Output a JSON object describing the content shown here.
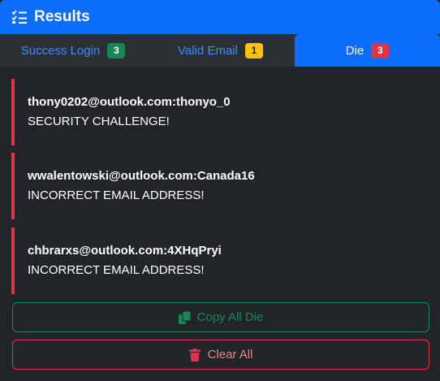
{
  "header": {
    "title": "Results",
    "icon": "list-check-icon"
  },
  "tabs": [
    {
      "label": "Success Login",
      "count": "3",
      "badge_color": "#198754"
    },
    {
      "label": "Valid Email",
      "count": "1",
      "badge_color": "#ffc107"
    },
    {
      "label": "Die",
      "count": "3",
      "badge_color": "#dc3545",
      "active": true
    }
  ],
  "results": [
    {
      "account": "thony0202@outlook.com:thonyo_0",
      "message": "SECURITY CHALLENGE!"
    },
    {
      "account": "wwalentowski@outlook.com:Canada16",
      "message": "INCORRECT EMAIL ADDRESS!"
    },
    {
      "account": "chbrarxs@outlook.com:4XHqPryi",
      "message": "INCORRECT EMAIL ADDRESS!"
    }
  ],
  "buttons": {
    "copy_label": "Copy All Die",
    "copy_icon": "copy-icon",
    "clear_label": "Clear All",
    "clear_icon": "trash-icon"
  },
  "colors": {
    "primary": "#0d6efd",
    "success": "#198754",
    "warning": "#ffc107",
    "danger": "#dc3545",
    "background": "#212529"
  }
}
